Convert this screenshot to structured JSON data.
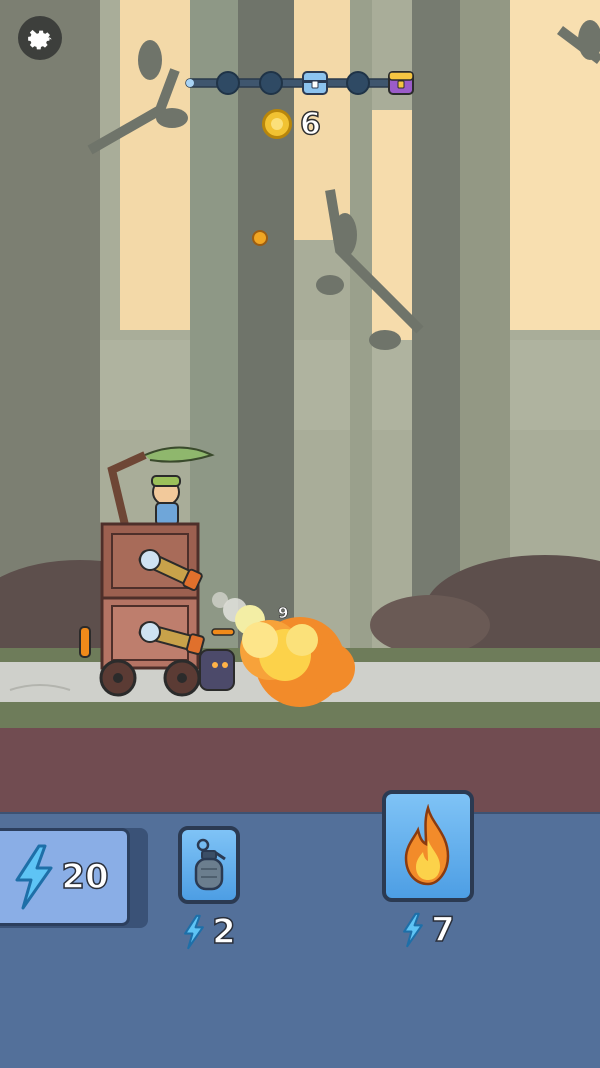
{
  "hud": {
    "settings_icon": "gear-icon",
    "stage_progress": {
      "nodes": [
        "node",
        "node",
        "chest-blue",
        "node",
        "chest-gold"
      ],
      "completed": 0,
      "track_color": "#3f566e",
      "node_color": "#2f4a64"
    },
    "coins": {
      "icon": "coin-icon",
      "value": "6"
    }
  },
  "battle": {
    "damage_number": "9",
    "player_health_color": "#f08a1a"
  },
  "abilities": {
    "energy": {
      "icon": "lightning-icon",
      "value": "20"
    },
    "grenade": {
      "icon": "grenade-icon",
      "cost_icon": "lightning-icon",
      "cost": "2"
    },
    "fire": {
      "icon": "fire-icon",
      "cost_icon": "lightning-icon",
      "cost": "7"
    }
  },
  "colors": {
    "sky": "#f8dfb0",
    "forest": "#a9ad99",
    "ground_grass": "#6e7c5a",
    "road": "#cfd0cb",
    "dirt": "#714c51",
    "panel": "#53709a",
    "lightning": "#5ec4f5"
  }
}
